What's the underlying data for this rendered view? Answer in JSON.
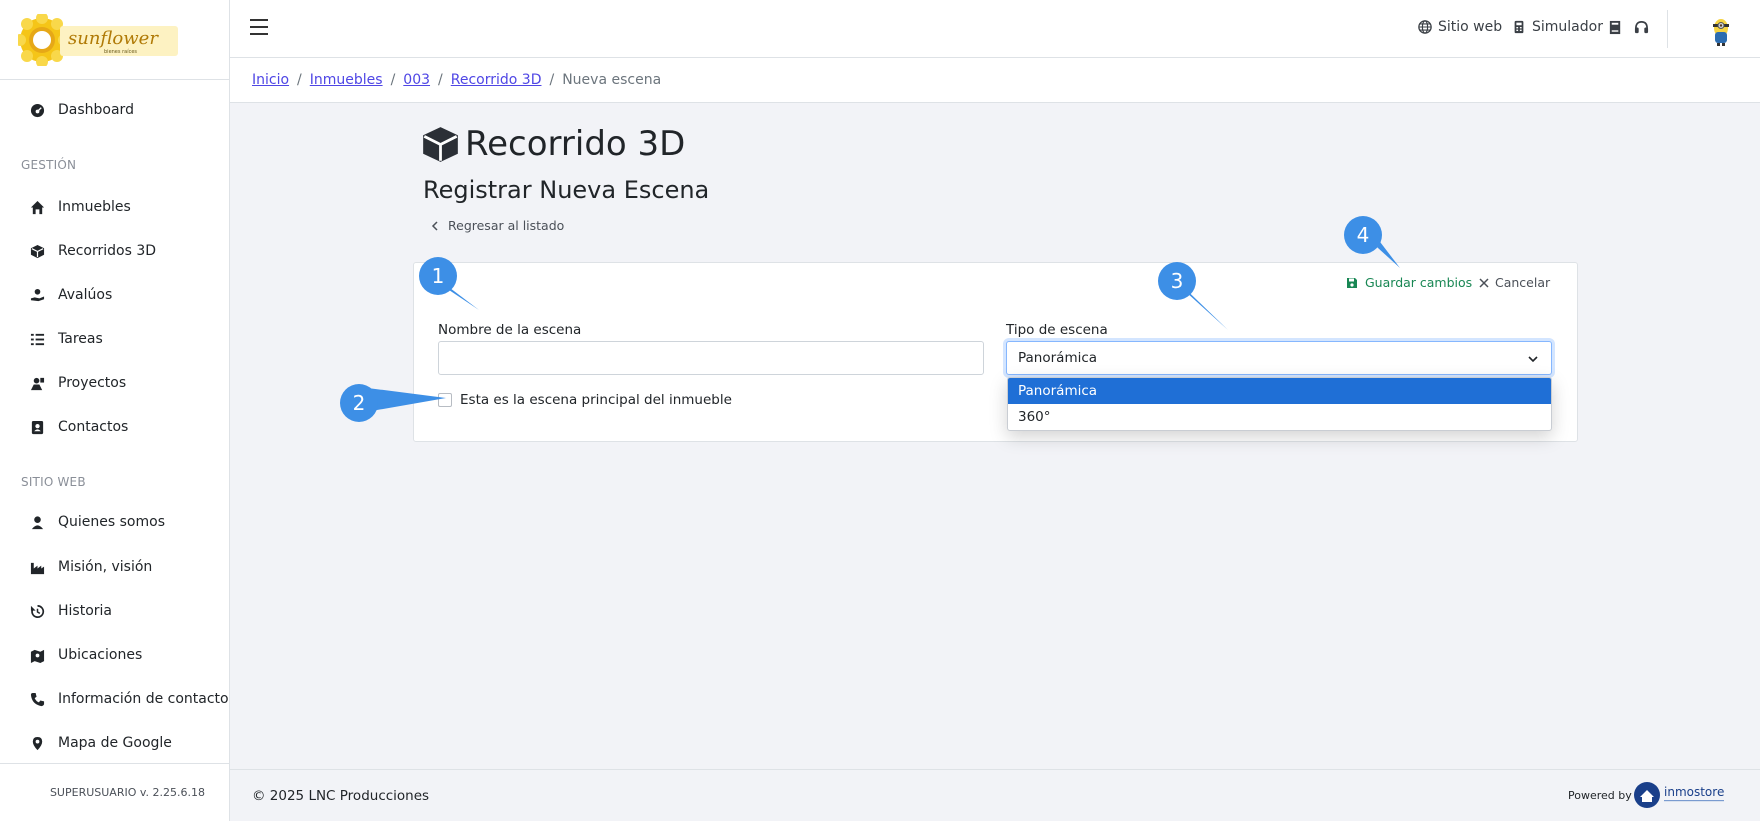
{
  "sidebar": {
    "logo_alt": "Sunflower",
    "items": [
      {
        "label": "Dashboard",
        "icon": "dashboard-icon"
      },
      {
        "label": "Inmuebles",
        "icon": "home-icon"
      },
      {
        "label": "Recorridos 3D",
        "icon": "cube-icon"
      },
      {
        "label": "Avalúos",
        "icon": "hand-coin-icon"
      },
      {
        "label": "Tareas",
        "icon": "tasks-icon"
      },
      {
        "label": "Proyectos",
        "icon": "projects-icon"
      },
      {
        "label": "Contactos",
        "icon": "contacts-icon"
      },
      {
        "label": "Quienes somos",
        "icon": "user-icon"
      },
      {
        "label": "Misión, visión",
        "icon": "industry-icon"
      },
      {
        "label": "Historia",
        "icon": "history-icon"
      },
      {
        "label": "Ubicaciones",
        "icon": "map-icon"
      },
      {
        "label": "Información de contacto",
        "icon": "phone-icon"
      },
      {
        "label": "Mapa de Google",
        "icon": "map-pin-icon"
      }
    ],
    "sections": {
      "gestion": "GESTIÓN",
      "sitio_web": "SITIO WEB"
    },
    "version": "SUPERUSUARIO v. 2.25.6.18"
  },
  "topbar": {
    "sitio_web": "Sitio web",
    "simulador": "Simulador"
  },
  "breadcrumb": {
    "inicio": "Inicio",
    "inmuebles": "Inmuebles",
    "codigo": "003",
    "recorrido": "Recorrido 3D",
    "current": "Nueva escena",
    "sep": "/"
  },
  "page": {
    "title": "Recorrido 3D",
    "subtitle": "Registrar Nueva Escena",
    "back": "Regresar al listado"
  },
  "form": {
    "save": "Guardar cambios",
    "cancel": "Cancelar",
    "name_label": "Nombre de la escena",
    "name_value": "",
    "type_label": "Tipo de escena",
    "type_value": "Panorámica",
    "type_options": [
      "Panorámica",
      "360°"
    ],
    "main_scene_label": "Esta es la escena principal del inmueble"
  },
  "callouts": [
    "1",
    "2",
    "3",
    "4"
  ],
  "footer": {
    "copyright": "© 2025 LNC Producciones",
    "powered": "Powered by"
  },
  "colors": {
    "accent": "#4f46e5",
    "success": "#198754",
    "callout": "#3d8fe6",
    "selected_option": "#1f6fd6"
  }
}
